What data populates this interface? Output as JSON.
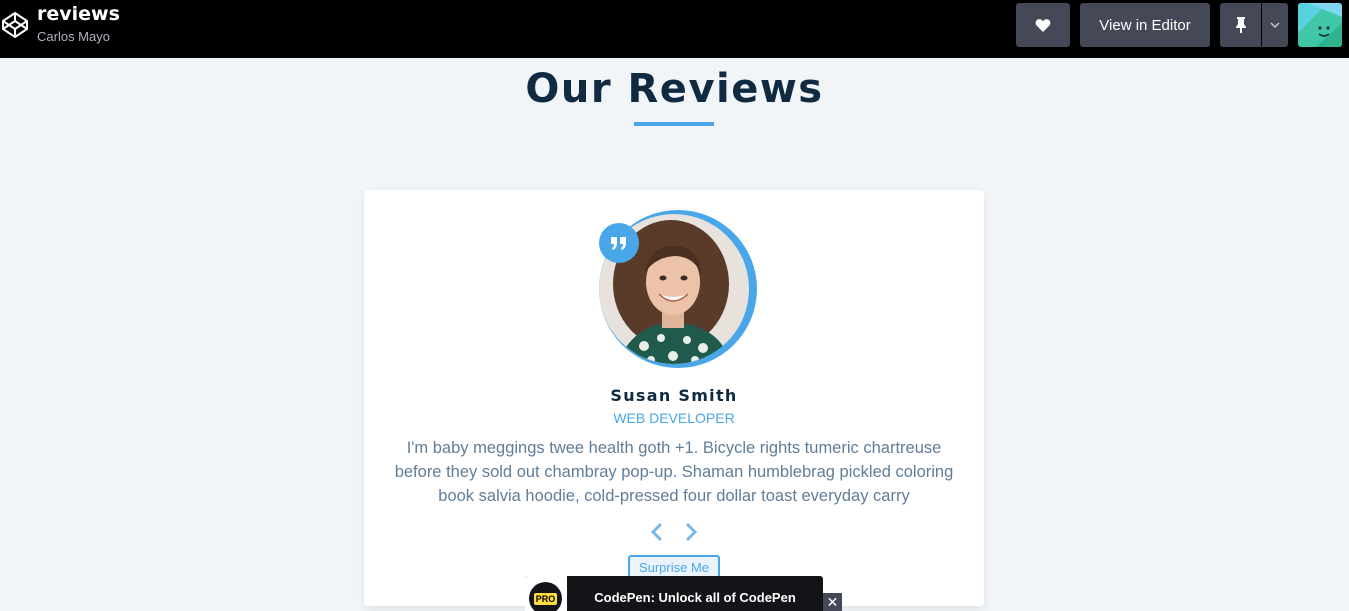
{
  "header": {
    "title": "reviews",
    "author": "Carlos Mayo",
    "view_in_editor_label": "View in Editor"
  },
  "icons": {
    "logo": "codepen-logo-icon",
    "heart": "heart-icon",
    "pin": "pin-icon",
    "dropdown": "chevron-down-icon",
    "quote": "quote-icon",
    "prev": "chevron-left-icon",
    "next": "chevron-right-icon",
    "close": "close-icon"
  },
  "main": {
    "title": "Our Reviews"
  },
  "review": {
    "name": "Susan Smith",
    "job": "web developer",
    "text": "I'm baby meggings twee health goth +1. Bicycle rights tumeric chartreuse before they sold out chambray pop-up. Shaman humblebrag pickled coloring book salvia hoodie, cold-pressed four dollar toast everyday carry",
    "surprise_label": "Surprise Me"
  },
  "banner": {
    "badge": "PRO",
    "text": "CodePen: Unlock all of CodePen",
    "close": "✕"
  },
  "colors": {
    "primary": "#49a6e9",
    "heading": "#102a42",
    "body_text": "#617d98",
    "background": "#f1f5f8"
  }
}
